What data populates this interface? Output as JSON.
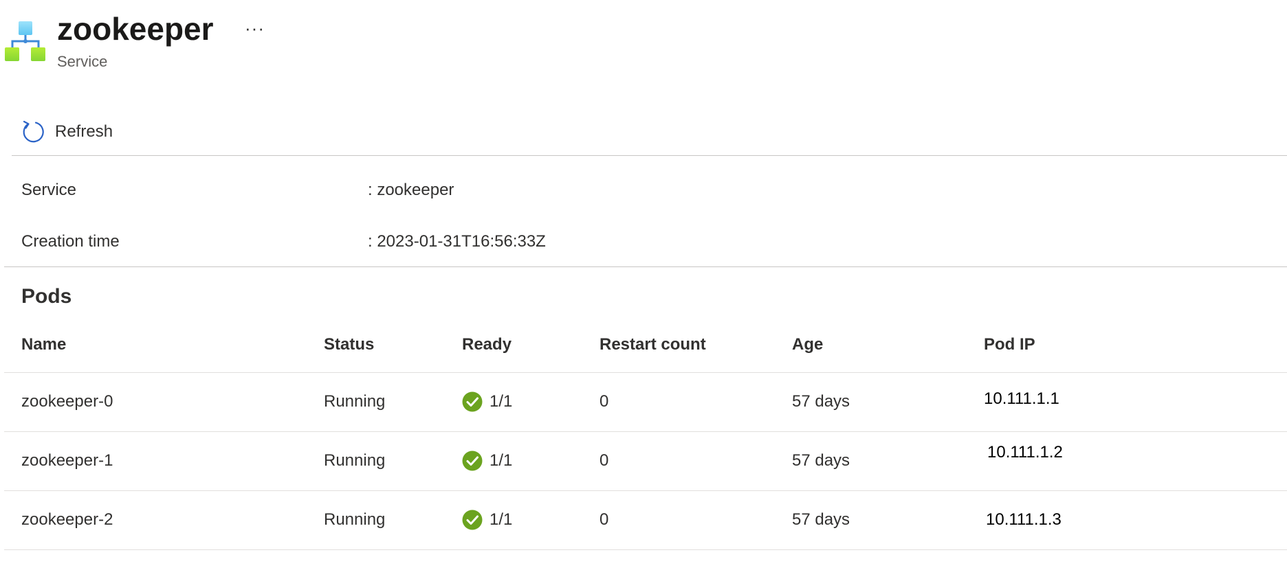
{
  "header": {
    "title": "zookeeper",
    "subtitle": "Service",
    "more_label": "···",
    "icon": "service-network-icon"
  },
  "toolbar": {
    "refresh_label": "Refresh",
    "refresh_icon": "refresh-icon"
  },
  "info": {
    "rows": [
      {
        "label": "Service",
        "value": ": zookeeper"
      },
      {
        "label": "Creation time",
        "value": ": 2023-01-31T16:56:33Z"
      }
    ]
  },
  "pods": {
    "title": "Pods",
    "columns": [
      "Name",
      "Status",
      "Ready",
      "Restart count",
      "Age",
      "Pod IP"
    ],
    "rows": [
      {
        "name": "zookeeper-0",
        "status": "Running",
        "ready": "1/1",
        "restart_count": "0",
        "age": "57 days",
        "pod_ip": "10.111.1.1"
      },
      {
        "name": "zookeeper-1",
        "status": "Running",
        "ready": "1/1",
        "restart_count": "0",
        "age": "57 days",
        "pod_ip": "10.111.1.2"
      },
      {
        "name": "zookeeper-2",
        "status": "Running",
        "ready": "1/1",
        "restart_count": "0",
        "age": "57 days",
        "pod_ip": "10.111.1.3"
      }
    ],
    "ready_icon": "check-circle-icon"
  },
  "colors": {
    "success": "#6bb700",
    "accent": "#0078d4",
    "divider": "#c8c6c4",
    "text": "#323130",
    "subtle_text": "#605e5c"
  }
}
